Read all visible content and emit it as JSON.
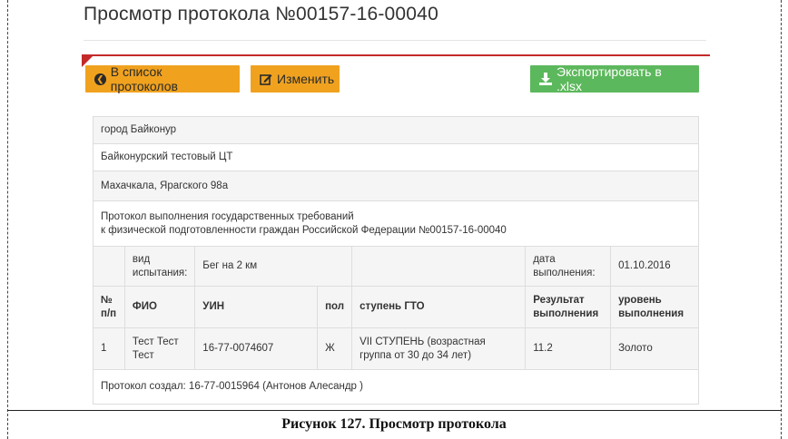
{
  "page": {
    "title": "Просмотр протокола №00157-16-00040"
  },
  "toolbar": {
    "back_label": "В список протоколов",
    "edit_label": "Изменить",
    "export_label": "Экспортировать в .xlsx"
  },
  "protocol": {
    "city": "город Байконур",
    "center": "Байконурский тестовый ЦТ",
    "address": "Махачкала, Ярагского 98а",
    "title_line1": "Протокол выполнения государственных требований",
    "title_line2": "к физической подготовленности граждан Российской Федерации №00157-16-00040",
    "test_kind_label": "вид испытания:",
    "test_kind_value": "Бег на 2 км",
    "date_label": "дата выполнения:",
    "date_value": "01.10.2016",
    "footer": "Протокол создал: 16-77-0015964 (Антонов Алесандр )"
  },
  "results": {
    "columns": [
      "№ п/п",
      "ФИО",
      "УИН",
      "пол",
      "ступень ГТО",
      "Результат выполнения",
      "уровень выполнения"
    ],
    "rows": [
      {
        "num": "1",
        "fio": "Тест Тест Тест",
        "uin": "16-77-0074607",
        "sex": "Ж",
        "stage": "VII СТУПЕНЬ (возрастная группа от 30 до 34 лет)",
        "result": "11.2",
        "level": "Золото"
      }
    ]
  },
  "caption": "Рисунок 127. Просмотр протокола",
  "colors": {
    "orange_button": "#f0a21f",
    "green_button": "#5cb85c",
    "panel_accent": "#c42a2a"
  },
  "icons": {
    "back": "circle-arrow-left-icon",
    "edit": "edit-icon",
    "export": "download-icon"
  }
}
